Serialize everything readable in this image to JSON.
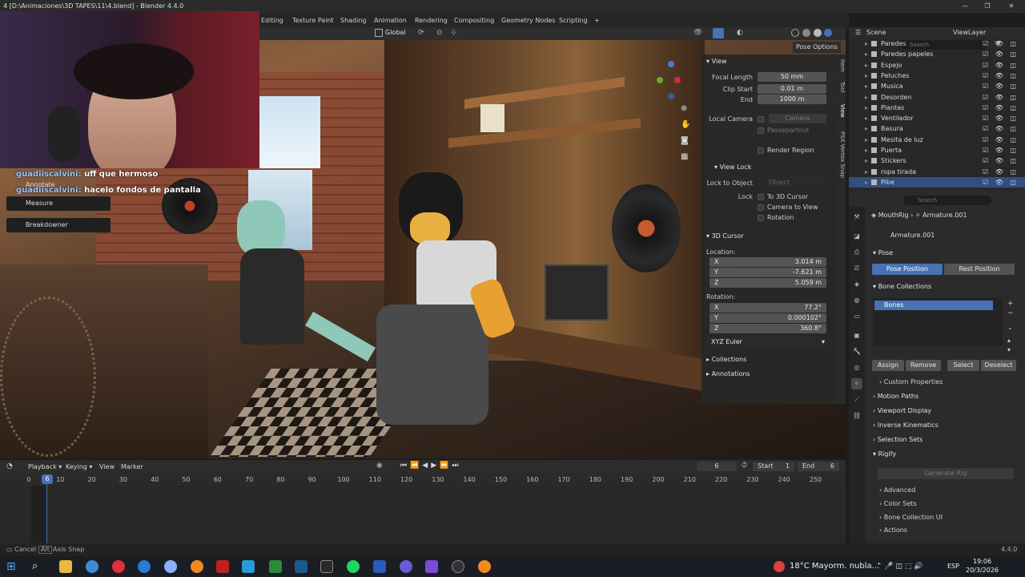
{
  "window": {
    "title": "4 [D:\\Animaciones\\3D TAPES\\11\\4.blend] - Blender 4.4.0",
    "controls": [
      "—",
      "❐",
      "✕"
    ]
  },
  "workspaces": [
    "Editing",
    "Texture Paint",
    "Shading",
    "Animation",
    "Rendering",
    "Compositing",
    "Geometry Nodes",
    "Scripting",
    "+"
  ],
  "viewport_header": {
    "orientation": "Global",
    "pose_options": "Pose Options"
  },
  "chat": [
    {
      "user": "guadiiscalvini:",
      "message": "uff que hermoso"
    },
    {
      "user": "guadiiscalvini:",
      "message": "hacelo fondos de pantalla"
    }
  ],
  "tools": [
    "Annotate",
    "Measure",
    "Breakdowner"
  ],
  "npanel": {
    "view": {
      "header": "View",
      "focal_length_label": "Focal Length",
      "focal_length": "50 mm",
      "clip_start_label": "Clip Start",
      "clip_start": "0.01 m",
      "end_label": "End",
      "end": "1000 m",
      "local_camera_label": "Local Camera",
      "local_camera": "Camera",
      "passepartout": "Passepartout",
      "render_region": "Render Region"
    },
    "view_lock": {
      "header": "View Lock",
      "lock_to_object_label": "Lock to Object",
      "lock_to_object_placeholder": "Object",
      "lock_label": "Lock",
      "to_3d_cursor": "To 3D Cursor",
      "camera_to_view": "Camera to View",
      "rotation": "Rotation"
    },
    "cursor": {
      "header": "3D Cursor",
      "location_label": "Location:",
      "lx": "3.014 m",
      "ly": "-7.621 m",
      "lz": "5.059 m",
      "rotation_label": "Rotation:",
      "rx": "77.2°",
      "ry": "0.000102°",
      "rz": "360.8°",
      "mode": "XYZ Euler"
    },
    "collections": "Collections",
    "annotations": "Annotations",
    "tabs": [
      "Item",
      "Tool",
      "View",
      "PSX Vertex Snap"
    ]
  },
  "outliner": {
    "scene": "Scene",
    "view_layer": "ViewLayer",
    "search_placeholder": "Search",
    "rows": [
      "Paredes",
      "Paredes papeles",
      "Espejo",
      "Peluches",
      "Musica",
      "Desorden",
      "Plantas",
      "Ventilador",
      "Basura",
      "Mesita de luz",
      "Puerta",
      "Stickers",
      "ropa tirada",
      "Pibe"
    ]
  },
  "properties": {
    "search_placeholder": "Search",
    "breadcrumb_obj": "MouthRig",
    "breadcrumb_data": "Armature.001",
    "data_name": "Armature.001",
    "pose": "Pose",
    "pose_position": "Pose Position",
    "rest_position": "Rest Position",
    "bone_collections": "Bone Collections",
    "bones": "Bones",
    "assign": "Assign",
    "remove": "Remove",
    "select": "Select",
    "deselect": "Deselect",
    "custom_properties": "Custom Properties",
    "motion_paths": "Motion Paths",
    "viewport_display": "Viewport Display",
    "inverse_kinematics": "Inverse Kinematics",
    "selection_sets": "Selection Sets",
    "rigify": "Rigify",
    "generate_rig": "Generate Rig",
    "advanced": "Advanced",
    "color_sets": "Color Sets",
    "bone_collection_ui": "Bone Collection UI",
    "actions": "Actions"
  },
  "timeline": {
    "playback": "Playback",
    "keying": "Keying",
    "view": "View",
    "marker": "Marker",
    "current_frame": "6",
    "start_label": "Start",
    "start": "1",
    "end_label": "End",
    "end": "6",
    "ticks": [
      "0",
      "10",
      "20",
      "30",
      "40",
      "50",
      "60",
      "70",
      "80",
      "90",
      "100",
      "110",
      "120",
      "130",
      "140",
      "150",
      "160",
      "170",
      "180",
      "190",
      "200",
      "210",
      "220",
      "230",
      "240",
      "250"
    ],
    "playhead": "6"
  },
  "statusbar": {
    "cancel": "Cancel",
    "alt": "Alt",
    "axis_snap": "Axis Snap",
    "version": "4.4.0"
  },
  "taskbar": {
    "weather": "18°C  Mayorm. nubla...",
    "lang": "ESP",
    "time": "19:06",
    "date": "20/3/2026"
  }
}
